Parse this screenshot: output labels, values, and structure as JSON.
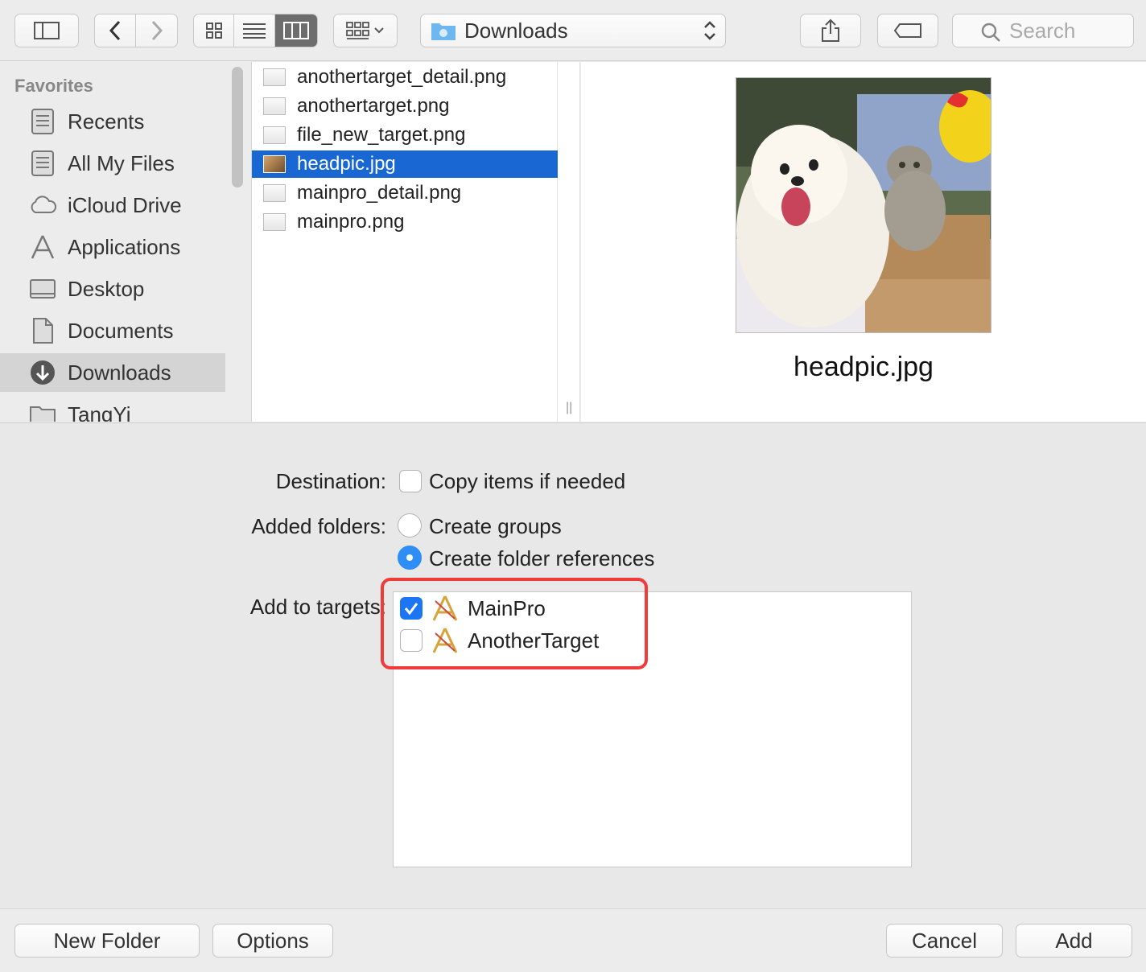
{
  "toolbar": {
    "path_label": "Downloads",
    "search_placeholder": "Search"
  },
  "sidebar": {
    "heading": "Favorites",
    "items": [
      {
        "label": "Recents",
        "icon": "recents-icon",
        "selected": false
      },
      {
        "label": "All My Files",
        "icon": "all-files-icon",
        "selected": false
      },
      {
        "label": "iCloud Drive",
        "icon": "cloud-icon",
        "selected": false
      },
      {
        "label": "Applications",
        "icon": "applications-icon",
        "selected": false
      },
      {
        "label": "Desktop",
        "icon": "desktop-icon",
        "selected": false
      },
      {
        "label": "Documents",
        "icon": "documents-icon",
        "selected": false
      },
      {
        "label": "Downloads",
        "icon": "download-icon",
        "selected": true
      },
      {
        "label": "TangYi",
        "icon": "folder-icon",
        "selected": false
      }
    ]
  },
  "files": [
    {
      "name": "anothertarget_detail.png",
      "selected": false
    },
    {
      "name": "anothertarget.png",
      "selected": false
    },
    {
      "name": "file_new_target.png",
      "selected": false
    },
    {
      "name": "headpic.jpg",
      "selected": true
    },
    {
      "name": "mainpro_detail.png",
      "selected": false
    },
    {
      "name": "mainpro.png",
      "selected": false
    }
  ],
  "preview": {
    "filename": "headpic.jpg"
  },
  "options": {
    "destination_label": "Destination:",
    "copy_items_label": "Copy items if needed",
    "copy_items_checked": false,
    "added_folders_label": "Added folders:",
    "create_groups_label": "Create groups",
    "create_folder_refs_label": "Create folder references",
    "folder_mode": "folder-references",
    "add_to_targets_label": "Add to targets:",
    "targets": [
      {
        "name": "MainPro",
        "checked": true
      },
      {
        "name": "AnotherTarget",
        "checked": false
      }
    ]
  },
  "buttons": {
    "new_folder": "New Folder",
    "options": "Options",
    "cancel": "Cancel",
    "add": "Add"
  },
  "colors": {
    "selection": "#1967d2",
    "checkbox_on": "#1c75f2",
    "highlight": "#f03b3b"
  }
}
